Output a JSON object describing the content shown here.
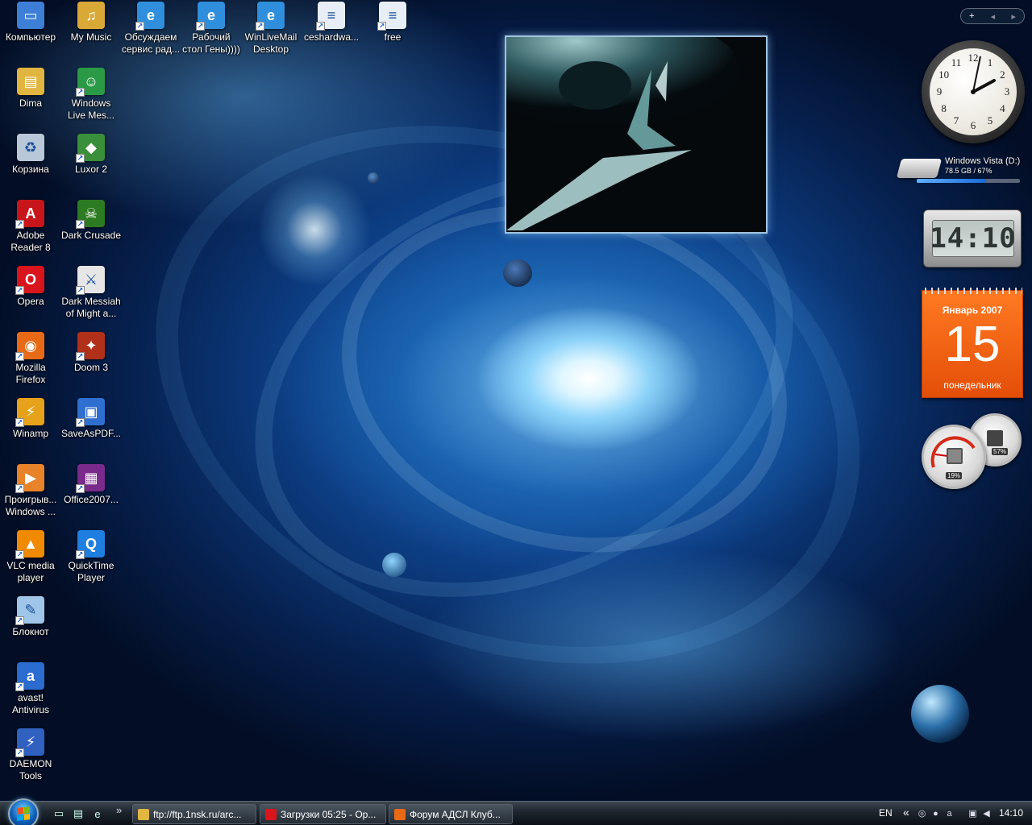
{
  "desktop_icons": [
    {
      "label": "Компьютер",
      "icon": "computer-icon",
      "color": "#3d7fd6"
    },
    {
      "label": "My Music",
      "icon": "music-folder-icon",
      "color": "#d9a937"
    },
    {
      "label": "Обсуждаем\nсервис рад...",
      "icon": "ie-shortcut-icon",
      "color": "#2f8fdc"
    },
    {
      "label": "Рабочий\nстол Гены))))",
      "icon": "ie-shortcut-icon",
      "color": "#2f8fdc"
    },
    {
      "label": "WinLiveMail\nDesktop",
      "icon": "ie-shortcut-icon",
      "color": "#2f8fdc"
    },
    {
      "label": "ceshardwa...",
      "icon": "document-icon",
      "color": "#e8eef5"
    },
    {
      "label": "free",
      "icon": "document-icon",
      "color": "#e8eef5"
    },
    {
      "label": "Dima",
      "icon": "folder-icon",
      "color": "#e0b540"
    },
    {
      "label": "Windows\nLive Mes...",
      "icon": "messenger-icon",
      "color": "#2b9a47"
    },
    {
      "label": "Корзина",
      "icon": "recycle-bin-icon",
      "color": "#b8c8d8"
    },
    {
      "label": "Luxor 2",
      "icon": "luxor-icon",
      "color": "#3a8f3a"
    },
    {
      "label": "Adobe\nReader 8",
      "icon": "adobe-reader-icon",
      "color": "#c8151b"
    },
    {
      "label": "Dark Crusade",
      "icon": "dark-crusade-icon",
      "color": "#2c7a22"
    },
    {
      "label": "Opera",
      "icon": "opera-icon",
      "color": "#d8141c"
    },
    {
      "label": "Dark Messiah\nof Might a...",
      "icon": "dark-messiah-icon",
      "color": "#e6e6e6"
    },
    {
      "label": "Mozilla\nFirefox",
      "icon": "firefox-icon",
      "color": "#e86a17"
    },
    {
      "label": "Doom 3",
      "icon": "doom-icon",
      "color": "#b0301a"
    },
    {
      "label": "Winamp",
      "icon": "winamp-icon",
      "color": "#e6a21b"
    },
    {
      "label": "SaveAsPDF...",
      "icon": "save-as-pdf-icon",
      "color": "#2f6fd0"
    },
    {
      "label": "Проигрыв...\nWindows ...",
      "icon": "media-player-icon",
      "color": "#e8832a"
    },
    {
      "label": "Office2007...",
      "icon": "winrar-icon",
      "color": "#7a2a8a"
    },
    {
      "label": "VLC media\nplayer",
      "icon": "vlc-icon",
      "color": "#f08a00"
    },
    {
      "label": "QuickTime\nPlayer",
      "icon": "quicktime-icon",
      "color": "#1f7fe0"
    },
    {
      "label": "Блокнот",
      "icon": "notepad-icon",
      "color": "#9fc5e8"
    },
    {
      "label": "avast!\nAntivirus",
      "icon": "avast-icon",
      "color": "#2a6cd0"
    },
    {
      "label": "DAEMON\nTools",
      "icon": "daemon-tools-icon",
      "color": "#3060c0"
    }
  ],
  "sidebar": {
    "controls": {
      "add": "+",
      "prev": "◂",
      "next": "▸"
    },
    "clock": {
      "numbers": [
        "12",
        "1",
        "2",
        "3",
        "4",
        "5",
        "6",
        "7",
        "8",
        "9",
        "10",
        "11"
      ]
    },
    "drive": {
      "name": "Windows Vista (D:)",
      "stats": "78.5 GB / 67%",
      "used_fraction": 0.67
    },
    "digital_clock": {
      "time": "14:10"
    },
    "calendar": {
      "month": "Январь 2007",
      "day": "15",
      "weekday": "понедельник"
    },
    "meters": {
      "cpu": "19%",
      "memory": "57%"
    }
  },
  "taskbar": {
    "quick_launch_icons": [
      "show-desktop-icon",
      "switch-windows-icon",
      "ie-icon"
    ],
    "quick_launch_more": "»",
    "buttons": [
      {
        "label": "ftp://ftp.1nsk.ru/arc...",
        "icon": "folder-icon",
        "color": "#e0b540"
      },
      {
        "label": "Загрузки 05:25 - Op...",
        "icon": "opera-icon",
        "color": "#d8141c"
      },
      {
        "label": "Форум АДСЛ Клуб...",
        "icon": "firefox-icon",
        "color": "#e86a17"
      }
    ],
    "language": "EN",
    "tray_expand": "«",
    "time": "14:10"
  }
}
